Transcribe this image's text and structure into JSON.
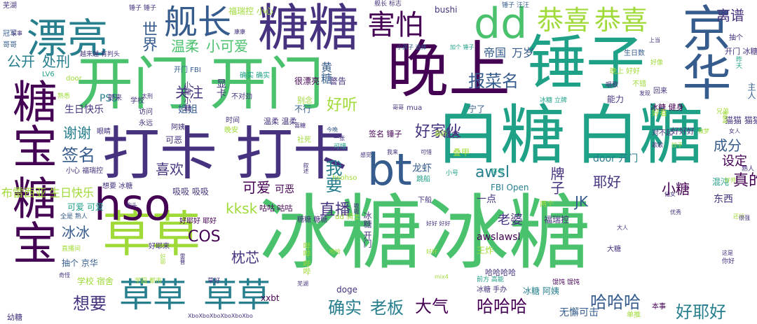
{
  "palette": {
    "purple": "#440154",
    "indigo": "#46327e",
    "blue": "#365c8d",
    "teal": "#277f8e",
    "cyan": "#1fa187",
    "green": "#4ac16d",
    "lime": "#a0da39",
    "yellow": "#dde318"
  },
  "words": [
    "冰糖",
    "冰糖",
    "白糖",
    "白糖",
    "打卡",
    "打卡",
    "开门",
    "开门",
    "晚上",
    "锤子",
    "糖糖",
    "糖宝",
    "糖宝",
    "漂亮",
    "草草",
    "草草",
    "草草",
    "hso",
    "bt",
    "dd",
    "舰长",
    "京华",
    "害怕",
    "恭喜",
    "恭喜",
    "离谱",
    "世界",
    "温柔",
    "小可爱",
    "公开",
    "处刑",
    "报菜名",
    "帝国",
    "万岁",
    "关注",
    "好听",
    "谢谢",
    "签名",
    "喜欢",
    "可爱",
    "awsl",
    "耶好",
    "小糖",
    "我要",
    "直播",
    "kksk",
    "COS",
    "枕芯",
    "想要",
    "确实",
    "老板",
    "大气",
    "哈哈哈",
    "哈哈哈",
    "好耶好",
    "好家伙",
    "成分",
    "设定",
    "真的",
    "JK",
    "老婆",
    "冰冰",
    "牌子",
    "布雷西亚",
    "生日快乐",
    "生日快乐",
    "PS5",
    "芜湖",
    "冠军",
    "哥哥",
    "LV6",
    "door",
    "开门 FBI",
    "确实 确实",
    "很漂亮",
    "警告",
    "晚上 好好",
    "好像",
    "生日数",
    "开门 冰糖",
    "抽个",
    "上当",
    "越来越 有判头",
    "小孩子 选择",
    "加个 锤子",
    "舰长 标志",
    "锤子 汪汪",
    "bushi",
    "锤子 锤子",
    "福瑞控 小心",
    "康康",
    "宁了",
    "冰糖 健身",
    "冰糖 立牌",
    "猫猫 猫猫",
    "兄弟",
    "主人",
    "昨天",
    "社死",
    "可惜",
    "暴躁",
    "叠甲",
    "龙虾",
    "跳船",
    "符号",
    "小号",
    "door 开门",
    "hsohso",
    "FBI Open",
    "混沌",
    "东西",
    "福瑞控",
    "下船",
    "一点",
    "两个",
    "可恶",
    "咕咕 咕咕",
    "糖糖 糖糖",
    "dd 骑士",
    "王炸",
    "awslawsl",
    "哈哈哈哈",
    "mix4",
    "前方 高能",
    "冰糖 手办",
    "冰糖 阿姨",
    "馄饨 馄饨",
    "本事",
    "单推",
    "无懈可击",
    "xxbt",
    "doge",
    "草好",
    "学校 宿舍",
    "学园 都市",
    "吸吸 吸吸",
    "想要 冰糖",
    "小心 福瑞控",
    "抽个 京华",
    "直播间",
    "全是 熟人",
    "可爱 可爱",
    "幼糖",
    "XboXboXboXboXboXbo",
    "好耶来",
    "大糖",
    "冰糖 开门",
    "好耶好 耶好",
    "哔哔 哔哔",
    "大人",
    "你好",
    "好好好",
    "熟人",
    "可恶",
    "太刑",
    "温柔 温柔",
    "喜糖",
    "今晚",
    "签名 锤子",
    "宿舍",
    "感觉",
    "我来",
    "一张",
    "可惜",
    "即来",
    "姐姐",
    "不行",
    "访问",
    "永远",
    "阿姨",
    "时间",
    "晚安",
    "学校",
    "眼睛",
    "显卡",
    "不对劲",
    "mua",
    "能力",
    "回来",
    "好看",
    "唱歌",
    "发现",
    "不错",
    "女人",
    "做梦",
    "歌歌",
    "对不起",
    "饺子",
    "嘉嘉",
    "叙述",
    "嗷嗷",
    "还行",
    "很强",
    "别念",
    "好耶",
    "雷普",
    "狗头",
    "芜湖",
    "奇怪",
    "没事",
    "哥哥",
    "好好",
    "仙女",
    "好帅",
    "优秀",
    "熟悉",
    "黄糖",
    "小糖 小糖",
    "这是",
    "好好 好好",
    "哈哈",
    "吸吸"
  ]
}
